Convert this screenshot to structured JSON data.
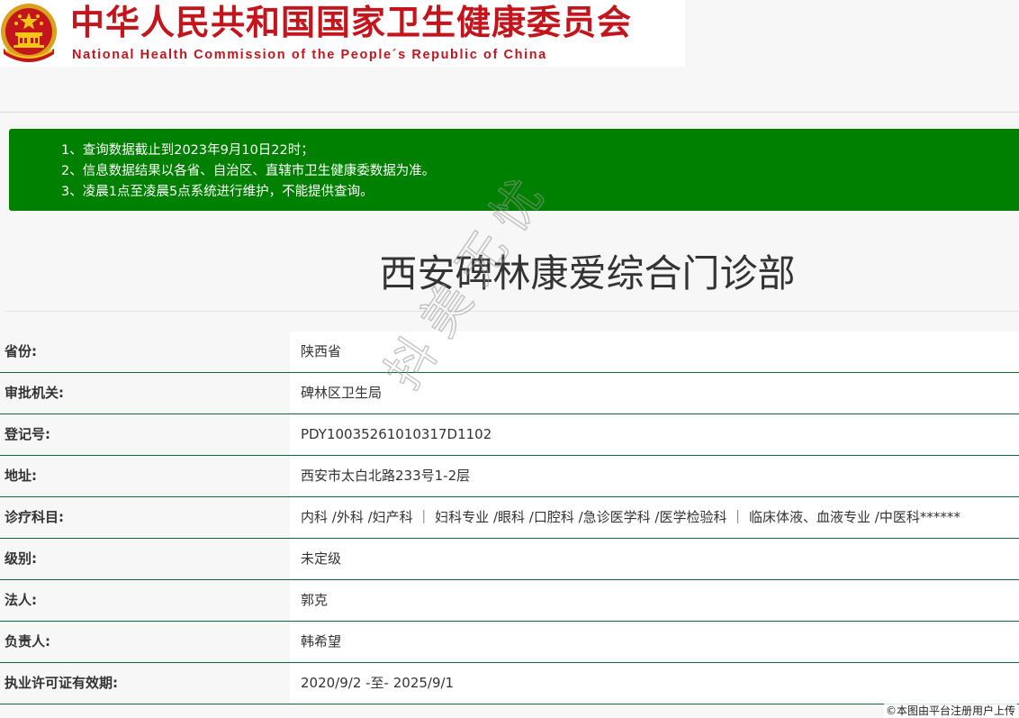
{
  "header": {
    "title_cn": "中华人民共和国国家卫生健康委员会",
    "title_en": "National Health Commission of the People´s Republic of China",
    "emblem_icon": "national-emblem-icon",
    "brand_color": "#c4151c"
  },
  "notice": {
    "background_color": "#008000",
    "lines": [
      "1、查询数据截止到2023年9月10日22时；",
      "2、信息数据结果以各省、自治区、直辖市卫生健康委数据为准。",
      "3、凌晨1点至凌晨5点系统进行维护，不能提供查询。"
    ]
  },
  "page_title": "西安碑林康爱综合门诊部",
  "info": {
    "rows": [
      {
        "label": "省份:",
        "value": "陕西省"
      },
      {
        "label": "审批机关:",
        "value": "碑林区卫生局"
      },
      {
        "label": "登记号:",
        "value": "PDY10035261010317D1102"
      },
      {
        "label": "地址:",
        "value": "西安市太白北路233号1-2层"
      },
      {
        "label": "诊疗科目:",
        "value": "内科 /外科 /妇产科 ｜ 妇科专业 /眼科 /口腔科 /急诊医学科 /医学检验科 ｜ 临床体液、血液专业 /中医科******"
      },
      {
        "label": "级别:",
        "value": "未定级"
      },
      {
        "label": "法人:",
        "value": "郭克"
      },
      {
        "label": "负责人:",
        "value": "韩希望"
      },
      {
        "label": "执业许可证有效期:",
        "value": "2020/9/2 -至- 2025/9/1"
      }
    ]
  },
  "watermark": "抖美无忧",
  "credit": "©本图由平台注册用户上传"
}
